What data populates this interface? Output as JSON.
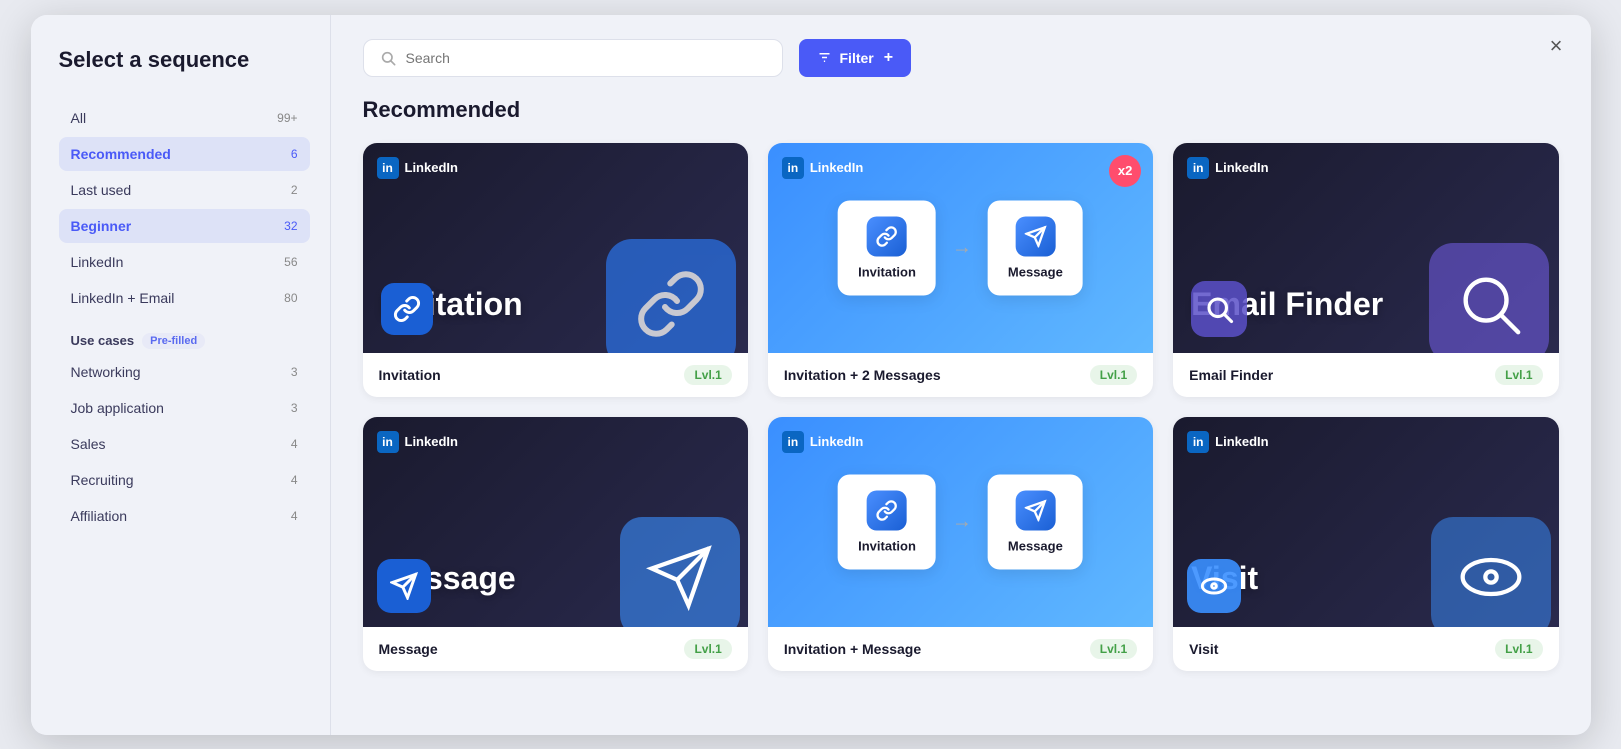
{
  "modal": {
    "title": "Select a sequence",
    "close_label": "×"
  },
  "sidebar": {
    "title": "Select a sequence",
    "items": [
      {
        "id": "all",
        "label": "All",
        "count": "99+",
        "active": false
      },
      {
        "id": "recommended",
        "label": "Recommended",
        "count": "6",
        "active": true
      },
      {
        "id": "last-used",
        "label": "Last used",
        "count": "2",
        "active": false
      },
      {
        "id": "beginner",
        "label": "Beginner",
        "count": "32",
        "active": true
      },
      {
        "id": "linkedin",
        "label": "LinkedIn",
        "count": "56",
        "active": false
      },
      {
        "id": "linkedin-email",
        "label": "LinkedIn + Email",
        "count": "80",
        "active": false
      }
    ],
    "use_cases_label": "Use cases",
    "pre_filled_badge": "Pre-filled",
    "use_case_items": [
      {
        "id": "networking",
        "label": "Networking",
        "count": "3"
      },
      {
        "id": "job-application",
        "label": "Job application",
        "count": "3"
      },
      {
        "id": "sales",
        "label": "Sales",
        "count": "4"
      },
      {
        "id": "recruiting",
        "label": "Recruiting",
        "count": "4"
      },
      {
        "id": "affiliation",
        "label": "Affiliation",
        "count": "4"
      }
    ]
  },
  "topbar": {
    "search_placeholder": "Search",
    "filter_label": "Filter"
  },
  "main": {
    "section_title": "Recommended",
    "cards": [
      {
        "id": "invitation",
        "name": "Invitation",
        "level": "Lvl.1",
        "bg": "dark",
        "platform": "LinkedIn",
        "type": "invitation"
      },
      {
        "id": "invitation-2-messages",
        "name": "Invitation + 2 Messages",
        "level": "Lvl.1",
        "bg": "blue",
        "platform": "LinkedIn",
        "type": "two-step"
      },
      {
        "id": "email-finder",
        "name": "Email Finder",
        "level": "Lvl.1",
        "bg": "dark",
        "platform": "LinkedIn",
        "type": "email-finder"
      },
      {
        "id": "message",
        "name": "Message",
        "level": "Lvl.1",
        "bg": "dark",
        "platform": "LinkedIn",
        "type": "message"
      },
      {
        "id": "invitation-message",
        "name": "Invitation + Message",
        "level": "Lvl.1",
        "bg": "blue",
        "platform": "LinkedIn",
        "type": "two-step-2"
      },
      {
        "id": "visit",
        "name": "Visit",
        "level": "Lvl.1",
        "bg": "dark",
        "platform": "LinkedIn",
        "type": "visit"
      }
    ]
  },
  "icons": {
    "search": "🔍",
    "filter": "⚙",
    "close": "✕",
    "linkedin_in": "in"
  }
}
